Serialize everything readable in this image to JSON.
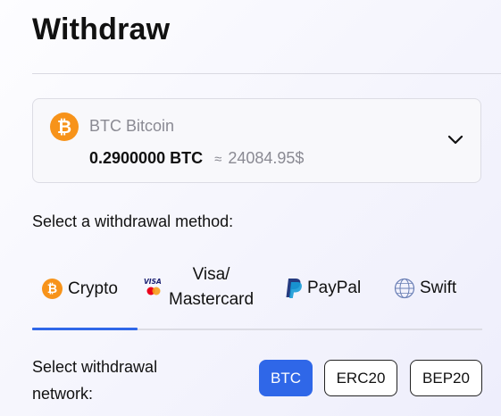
{
  "header": {
    "title": "Withdraw"
  },
  "asset": {
    "icon": "bitcoin-icon",
    "coin_glyph": "₿",
    "name": "BTC Bitcoin",
    "balance": "0.2900000 BTC",
    "approx_symbol": "≈",
    "fiat_value": "24084.95$",
    "dropdown_icon": "chevron-down-icon"
  },
  "method": {
    "label": "Select a withdrawal method:",
    "tabs": [
      {
        "label": "Crypto",
        "icon": "bitcoin-icon",
        "glyph": "₿",
        "selected": true
      },
      {
        "label_line1": "Visa/",
        "label_line2": "Mastercard",
        "icon": "visa-mastercard-icon",
        "selected": false
      },
      {
        "label": "PayPal",
        "icon": "paypal-icon",
        "selected": false
      },
      {
        "label": "Swift",
        "icon": "swift-icon",
        "selected": false
      }
    ]
  },
  "network": {
    "label_line1": "Select withdrawal",
    "label_line2": "network:",
    "options": [
      "BTC",
      "ERC20",
      "BEP20"
    ],
    "selected": "BTC"
  },
  "colors": {
    "accent": "#2f67e8",
    "bitcoin": "#f7931a",
    "paypal_dark": "#253b80",
    "paypal_light": "#179bd7"
  }
}
